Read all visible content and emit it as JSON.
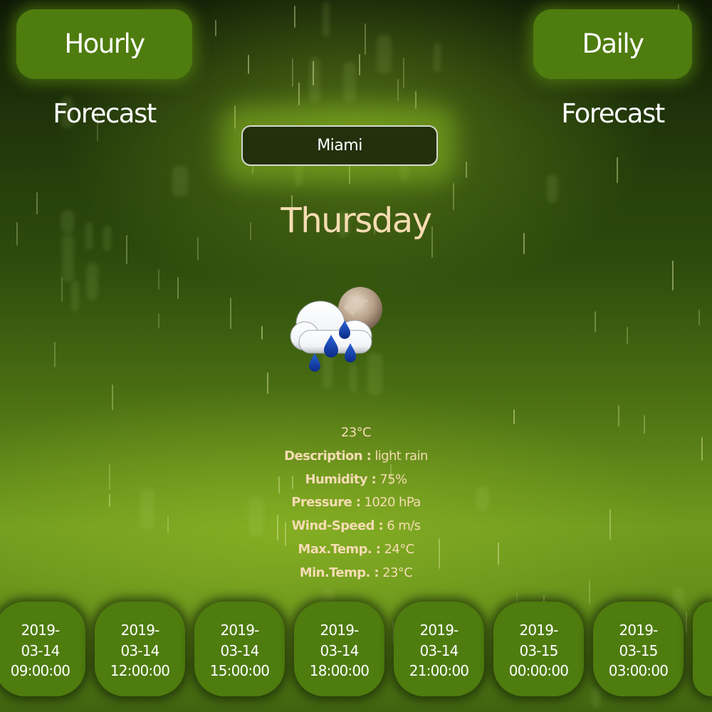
{
  "nav": {
    "hourly_label": "Hourly Forecast",
    "daily_label": "Daily Forecast"
  },
  "search": {
    "value": "Miami"
  },
  "current": {
    "day": "Thursday",
    "icon": "rain-cloud-moon-icon",
    "temp": "23°C",
    "description": {
      "label": "Description :",
      "value": " light rain"
    },
    "humidity": {
      "label": "Humidity :",
      "value": " 75%"
    },
    "pressure": {
      "label": "Pressure :",
      "value": " 1020 hPa"
    },
    "wind": {
      "label": "Wind-Speed :",
      "value": " 6 m/s"
    },
    "max_temp": {
      "label": "Max.Temp. :",
      "value": " 24°C"
    },
    "min_temp": {
      "label": "Min.Temp. :",
      "value": " 23°C"
    }
  },
  "hourly": [
    {
      "line1": "2019-",
      "line2": "03-14",
      "line3": "09:00:00"
    },
    {
      "line1": "2019-",
      "line2": "03-14",
      "line3": "12:00:00"
    },
    {
      "line1": "2019-",
      "line2": "03-14",
      "line3": "15:00:00"
    },
    {
      "line1": "2019-",
      "line2": "03-14",
      "line3": "18:00:00"
    },
    {
      "line1": "2019-",
      "line2": "03-14",
      "line3": "21:00:00"
    },
    {
      "line1": "2019-",
      "line2": "03-15",
      "line3": "00:00:00"
    },
    {
      "line1": "2019-",
      "line2": "03-15",
      "line3": "03:00:00"
    },
    {
      "line1": "",
      "line2": "",
      "line3": ""
    }
  ],
  "colors": {
    "button_green": "#4e7c0e",
    "text_cream": "#f6dcb3",
    "search_bg": "#22300c"
  }
}
